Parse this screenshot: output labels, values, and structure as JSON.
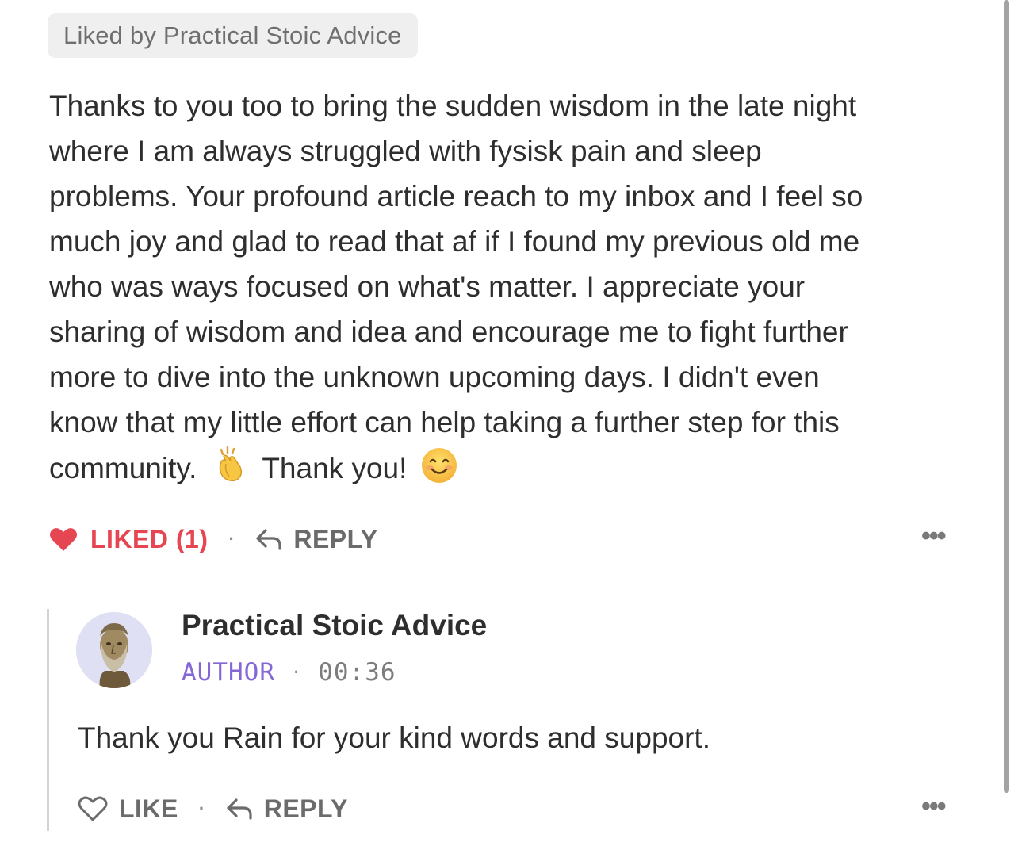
{
  "comment": {
    "liked_by": "Liked by Practical Stoic Advice",
    "lines": [
      "Thanks to you too to bring the sudden wisdom in the late night",
      "where I am always struggled with fysisk pain and sleep",
      "problems. Your profound article reach to my inbox and I feel so",
      "much joy and glad to read that af if I found my previous old me",
      "who was ways focused on what's matter. I appreciate  your",
      "sharing of wisdom and idea and encourage me to fight further",
      "more to dive into the unknown upcoming days. I didn't even",
      "know that my little effort can help taking a further step for this"
    ],
    "last_line_start": "community.",
    "last_line_end": "Thank you!",
    "emojis": [
      "clapping-hands",
      "smiling-face"
    ],
    "liked_label": "LIKED (1)",
    "reply_label": "REPLY",
    "more_label": "•••",
    "separator": "·"
  },
  "reply": {
    "author": "Practical Stoic Advice",
    "badge": "AUTHOR",
    "time": "00:36",
    "separator": "·",
    "text": "Thank you Rain for your kind words and support.",
    "like_label": "LIKE",
    "reply_label": "REPLY",
    "more_label": "•••"
  },
  "colors": {
    "liked": "#e64552",
    "author_badge": "#8566d6",
    "muted": "#6b6b6b",
    "text": "#2e2e2e"
  }
}
